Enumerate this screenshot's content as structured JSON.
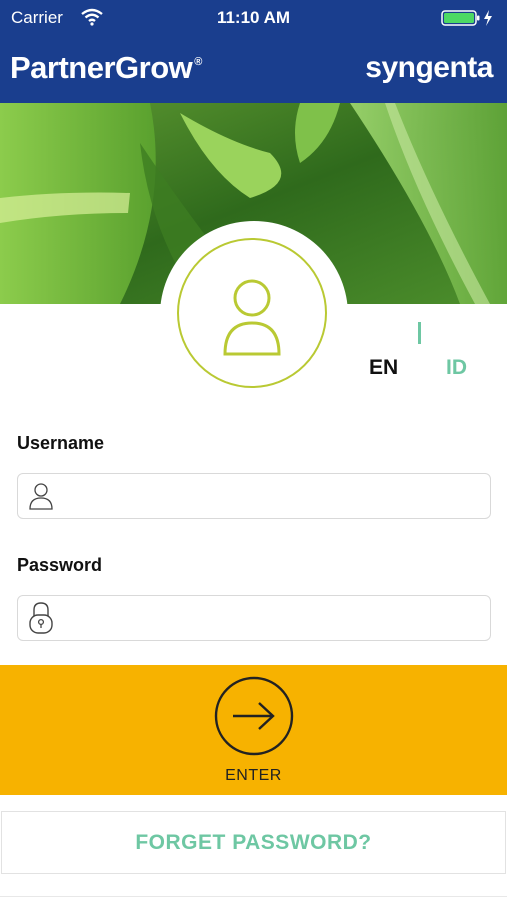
{
  "status_bar": {
    "carrier": "Carrier",
    "time": "11:10 AM"
  },
  "header": {
    "brand_left": "PartnerGrow",
    "brand_left_mark": "®",
    "brand_right": "syngenta"
  },
  "language": {
    "options": [
      "EN",
      "ID"
    ],
    "selected": "EN",
    "separator": "|"
  },
  "form": {
    "username": {
      "label": "Username",
      "value": "",
      "placeholder": ""
    },
    "password": {
      "label": "Password",
      "value": "",
      "placeholder": ""
    }
  },
  "enter": {
    "label": "ENTER"
  },
  "forget_password": {
    "label": "FORGET PASSWORD?"
  },
  "colors": {
    "brand_blue": "#1a3e8e",
    "accent_green": "#6ec7a3",
    "ring_green": "#b9c933",
    "enter_yellow": "#f7b200"
  }
}
